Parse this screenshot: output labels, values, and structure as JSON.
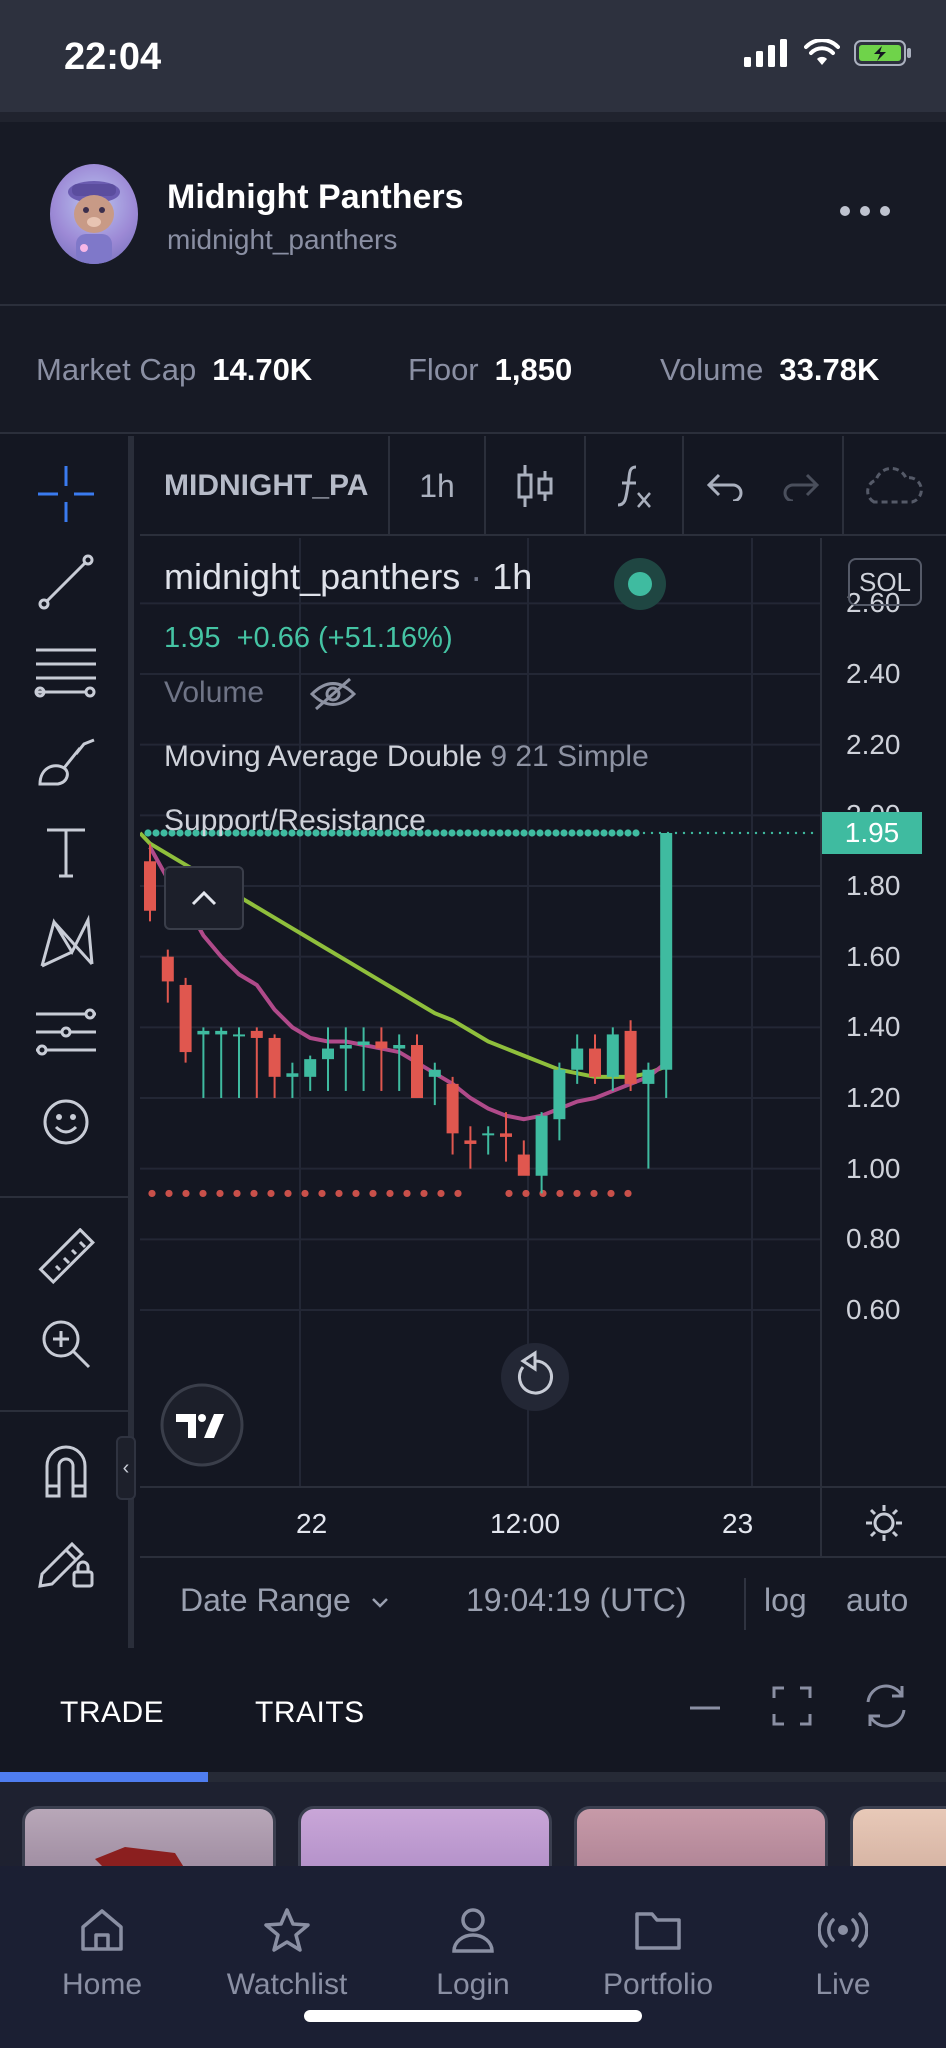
{
  "status_bar": {
    "time": "22:04"
  },
  "collection": {
    "name": "Midnight Panthers",
    "handle": "midnight_panthers"
  },
  "stats": [
    {
      "label": "Market Cap",
      "value": "14.70K"
    },
    {
      "label": "Floor",
      "value": "1,850"
    },
    {
      "label": "Volume",
      "value": "33.78K"
    }
  ],
  "toolbar": {
    "symbol": "MIDNIGHT_PA",
    "interval": "1h"
  },
  "legend": {
    "name": "midnight_panthers",
    "interval_sep": "·",
    "interval": "1h",
    "price": "1.95",
    "change": "+0.66 (+51.16%)",
    "volume": "Volume",
    "ma": "Moving Average Double",
    "ma_params": "9 21 Simple",
    "sr": "Support/Resistance"
  },
  "price_axis": {
    "unit": "SOL",
    "last_price": "1.95",
    "ticks": [
      "2.60",
      "2.40",
      "2.20",
      "2.00",
      "1.80",
      "1.60",
      "1.40",
      "1.20",
      "1.00",
      "0.80",
      "0.60"
    ]
  },
  "time_axis": {
    "ticks": [
      "22",
      "12:00",
      "23"
    ]
  },
  "chart_footer": {
    "date_range": "Date Range",
    "time": "19:04:19 (UTC)",
    "log": "log",
    "auto": "auto"
  },
  "bottom_tabs": {
    "trade": "TRADE",
    "traits": "TRAITS"
  },
  "progress": 0.22,
  "nav": [
    {
      "label": "Home",
      "icon": "home-icon"
    },
    {
      "label": "Watchlist",
      "icon": "star-icon"
    },
    {
      "label": "Login",
      "icon": "user-icon"
    },
    {
      "label": "Portfolio",
      "icon": "folder-icon"
    },
    {
      "label": "Live",
      "icon": "broadcast-icon"
    }
  ],
  "chart_data": {
    "type": "candlestick",
    "title": "midnight_panthers",
    "ylim": [
      0.5,
      2.7
    ],
    "candles": [
      {
        "o": 1.87,
        "h": 1.92,
        "l": 1.7,
        "c": 1.73
      },
      {
        "o": 1.6,
        "h": 1.62,
        "l": 1.47,
        "c": 1.53
      },
      {
        "o": 1.52,
        "h": 1.54,
        "l": 1.3,
        "c": 1.33
      },
      {
        "o": 1.38,
        "h": 1.4,
        "l": 1.2,
        "c": 1.39
      },
      {
        "o": 1.38,
        "h": 1.4,
        "l": 1.2,
        "c": 1.39
      },
      {
        "o": 1.38,
        "h": 1.4,
        "l": 1.2,
        "c": 1.38
      },
      {
        "o": 1.39,
        "h": 1.4,
        "l": 1.2,
        "c": 1.37
      },
      {
        "o": 1.37,
        "h": 1.38,
        "l": 1.2,
        "c": 1.26
      },
      {
        "o": 1.26,
        "h": 1.3,
        "l": 1.2,
        "c": 1.27
      },
      {
        "o": 1.26,
        "h": 1.32,
        "l": 1.22,
        "c": 1.31
      },
      {
        "o": 1.31,
        "h": 1.4,
        "l": 1.22,
        "c": 1.34
      },
      {
        "o": 1.34,
        "h": 1.4,
        "l": 1.22,
        "c": 1.35
      },
      {
        "o": 1.35,
        "h": 1.4,
        "l": 1.22,
        "c": 1.36
      },
      {
        "o": 1.36,
        "h": 1.4,
        "l": 1.22,
        "c": 1.34
      },
      {
        "o": 1.34,
        "h": 1.38,
        "l": 1.22,
        "c": 1.35
      },
      {
        "o": 1.35,
        "h": 1.38,
        "l": 1.2,
        "c": 1.2
      },
      {
        "o": 1.26,
        "h": 1.3,
        "l": 1.18,
        "c": 1.28
      },
      {
        "o": 1.24,
        "h": 1.26,
        "l": 1.04,
        "c": 1.1
      },
      {
        "o": 1.08,
        "h": 1.12,
        "l": 1.0,
        "c": 1.07
      },
      {
        "o": 1.1,
        "h": 1.12,
        "l": 1.04,
        "c": 1.1
      },
      {
        "o": 1.1,
        "h": 1.16,
        "l": 1.02,
        "c": 1.09
      },
      {
        "o": 1.04,
        "h": 1.08,
        "l": 0.99,
        "c": 0.98
      },
      {
        "o": 0.98,
        "h": 1.16,
        "l": 0.93,
        "c": 1.15
      },
      {
        "o": 1.14,
        "h": 1.3,
        "l": 1.08,
        "c": 1.28
      },
      {
        "o": 1.28,
        "h": 1.38,
        "l": 1.24,
        "c": 1.34
      },
      {
        "o": 1.34,
        "h": 1.38,
        "l": 1.24,
        "c": 1.26
      },
      {
        "o": 1.26,
        "h": 1.4,
        "l": 1.22,
        "c": 1.38
      },
      {
        "o": 1.39,
        "h": 1.42,
        "l": 1.22,
        "c": 1.24
      },
      {
        "o": 1.24,
        "h": 1.3,
        "l": 1.0,
        "c": 1.28
      },
      {
        "o": 1.28,
        "h": 1.95,
        "l": 1.2,
        "c": 1.95
      }
    ],
    "ma_fast": [
      1.91,
      1.82,
      1.75,
      1.66,
      1.6,
      1.55,
      1.52,
      1.45,
      1.4,
      1.37,
      1.36,
      1.36,
      1.35,
      1.34,
      1.33,
      1.3,
      1.27,
      1.24,
      1.2,
      1.17,
      1.15,
      1.14,
      1.15,
      1.17,
      1.19,
      1.2,
      1.22,
      1.24,
      1.26,
      1.3
    ],
    "ma_slow": [
      1.92,
      1.89,
      1.86,
      1.83,
      1.8,
      1.77,
      1.74,
      1.71,
      1.68,
      1.65,
      1.62,
      1.59,
      1.56,
      1.53,
      1.5,
      1.47,
      1.44,
      1.42,
      1.39,
      1.36,
      1.34,
      1.32,
      1.3,
      1.28,
      1.27,
      1.26,
      1.26,
      1.26,
      1.27,
      1.29
    ],
    "resistance": 1.95,
    "support": 0.93
  }
}
